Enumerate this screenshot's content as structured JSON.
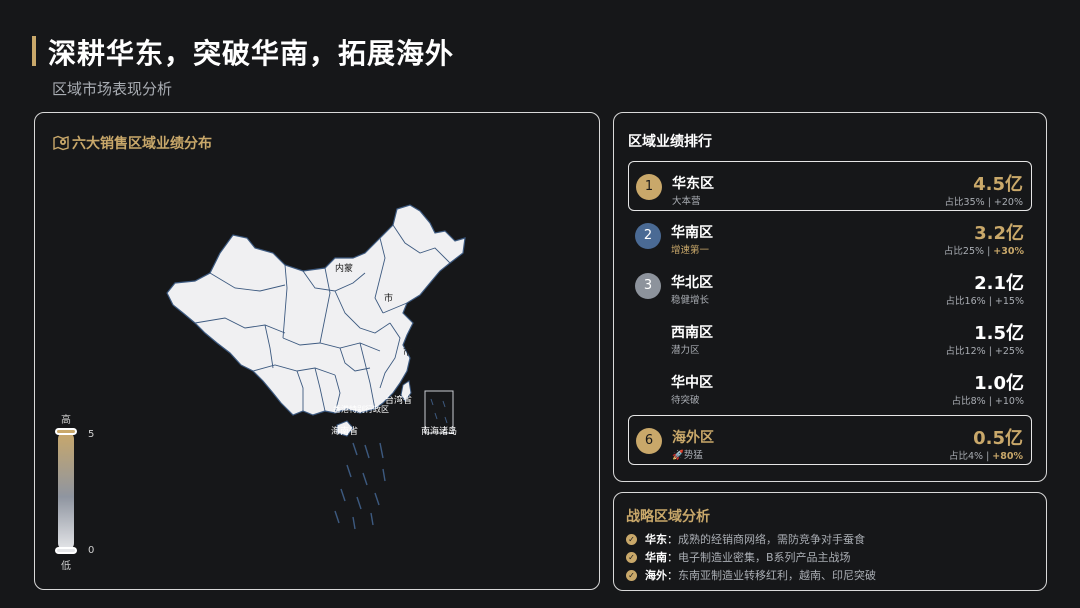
{
  "page": {
    "title": "深耕华东，突破华南，拓展海外",
    "subtitle": "区域市场表现分析"
  },
  "map_panel": {
    "heading": "六大销售区域业绩分布",
    "heading_icon": "map-marker-icon",
    "labels": {
      "inner_mongolia": "内蒙",
      "hebei": "市",
      "shanghai": "市",
      "taiwan": "台湾省",
      "hongkong_macao": "香港特别行政区",
      "hainan": "海南省",
      "south_sea": "南海诸岛"
    },
    "legend": {
      "high": "高",
      "low": "低",
      "max": "5",
      "min": "0"
    },
    "colors": {
      "land": "#f0f0f2",
      "border": "#3d5a80",
      "gradient_top": "#c9a86a",
      "gradient_bottom": "#e6e7ea"
    }
  },
  "ranking": {
    "heading": "区域业绩排行",
    "items": [
      {
        "rank": "1",
        "name": "华东区",
        "tag": "大本营",
        "value": "4.5亿",
        "share": "占比35%",
        "growth": "+20%",
        "highlight": true,
        "badge_color": "#c9a86a"
      },
      {
        "rank": "2",
        "name": "华南区",
        "tag": "增速第一",
        "value": "3.2亿",
        "share": "占比25%",
        "growth": "+30%",
        "highlight": false,
        "badge_color": "#4a6a94"
      },
      {
        "rank": "3",
        "name": "华北区",
        "tag": "稳健增长",
        "value": "2.1亿",
        "share": "占比16%",
        "growth": "+15%",
        "highlight": false,
        "badge_color": "#8d939c"
      },
      {
        "rank": "",
        "name": "西南区",
        "tag": "潜力区",
        "value": "1.5亿",
        "share": "占比12%",
        "growth": "+25%",
        "highlight": false,
        "badge_color": ""
      },
      {
        "rank": "",
        "name": "华中区",
        "tag": "待突破",
        "value": "1.0亿",
        "share": "占比8%",
        "growth": "+10%",
        "highlight": false,
        "badge_color": ""
      },
      {
        "rank": "6",
        "name": "海外区",
        "tag": "🚀势猛",
        "value": "0.5亿",
        "share": "占比4%",
        "growth": "+80%",
        "highlight": true,
        "badge_color": "#c9a86a"
      }
    ]
  },
  "strategy": {
    "heading": "战略区域分析",
    "items": [
      {
        "key": "华东",
        "text": "成熟的经销商网络，需防竞争对手蚕食"
      },
      {
        "key": "华南",
        "text": "电子制造业密集，B系列产品主战场"
      },
      {
        "key": "海外",
        "text": "东南亚制造业转移红利，越南、印尼突破"
      }
    ]
  }
}
